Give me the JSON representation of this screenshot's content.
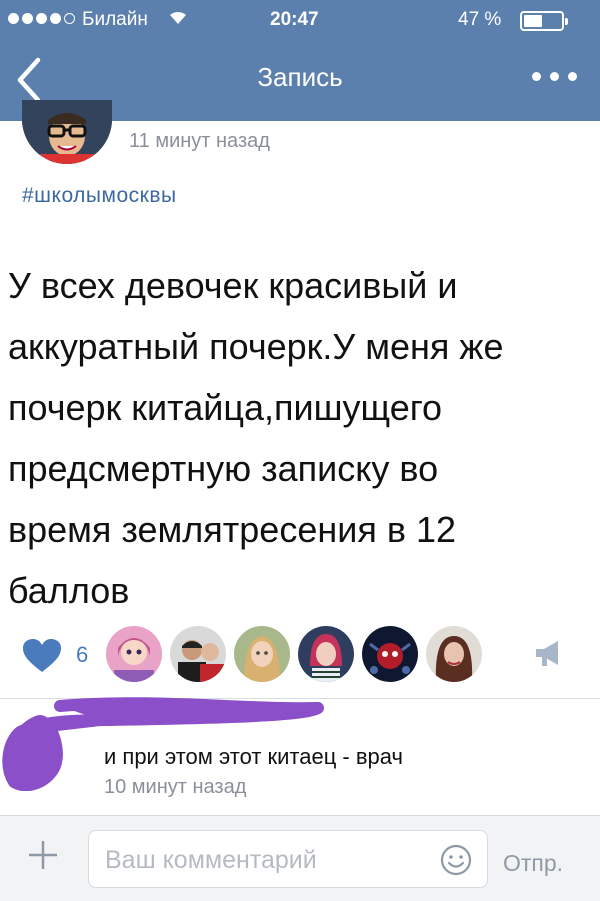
{
  "status_bar": {
    "carrier": "Билайн",
    "time": "20:47",
    "battery": "47 %",
    "battery_level": 0.47
  },
  "nav": {
    "title": "Запись",
    "back_icon": "chevron-left-icon",
    "menu_icon": "more-dots-icon"
  },
  "post": {
    "time_ago": "11 минут назад",
    "hashtag": "#школымосквы",
    "text_lines": [
      "У всех девочек красивый и",
      "аккуратный почерк.У меня же",
      "почерк китайца,пишущего",
      "предсмертную записку во",
      "время землятресения в 12",
      "баллов"
    ],
    "likes_count": "6",
    "liker_avatars": 6
  },
  "comment": {
    "text": "и при этом этот китаец - врач",
    "time": "10 минут назад"
  },
  "input_bar": {
    "placeholder": "Ваш комментарий",
    "send_label": "Отпр."
  },
  "colors": {
    "header_bg": "#5b80ae",
    "link": "#3d6a9e",
    "like": "#4a7bbd",
    "scribble": "#8a4fc9"
  }
}
